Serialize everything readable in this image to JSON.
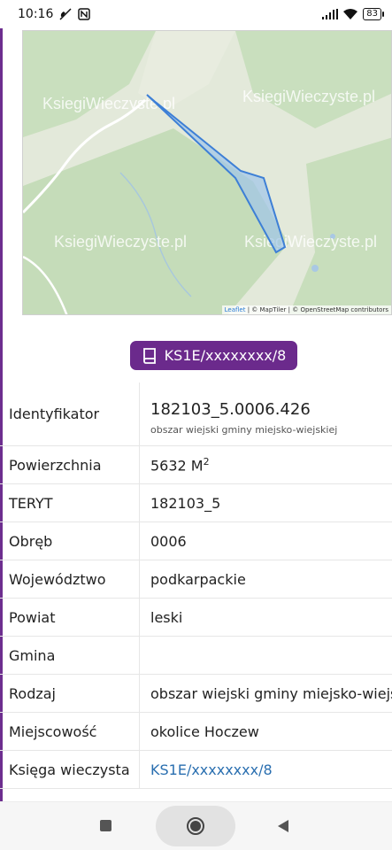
{
  "status_bar": {
    "time": "10:16",
    "battery": "83"
  },
  "map": {
    "watermark": "KsiegiWieczyste.pl",
    "attribution_leaflet": "Leaflet",
    "attribution_rest": " | © MapTiler | © OpenStreetMap contributors"
  },
  "kw_button": {
    "label": "KS1E/xxxxxxxx/8"
  },
  "table": {
    "identifier": {
      "label": "Identyfikator",
      "value": "182103_5.0006.426",
      "sub": "obszar wiejski gminy miejsko-wiejskiej"
    },
    "area": {
      "label": "Powierzchnia",
      "value": "5632 M",
      "unit_sup": "2"
    },
    "rows": [
      {
        "label": "TERYT",
        "value": "182103_5"
      },
      {
        "label": "Obręb",
        "value": "0006"
      },
      {
        "label": "Województwo",
        "value": "podkarpackie"
      },
      {
        "label": "Powiat",
        "value": "leski"
      },
      {
        "label": "Gmina",
        "value": ""
      },
      {
        "label": "Rodzaj",
        "value": "obszar wiejski gminy miejsko-wiejskiej"
      },
      {
        "label": "Miejscowość",
        "value": "okolice Hoczew"
      }
    ],
    "land_registry": {
      "label": "Księga wieczysta",
      "value": "KS1E/xxxxxxxx/8"
    }
  },
  "colors": {
    "accent": "#6b2a8c",
    "link": "#2a6fb0",
    "parcel": "#3d7fd6"
  }
}
